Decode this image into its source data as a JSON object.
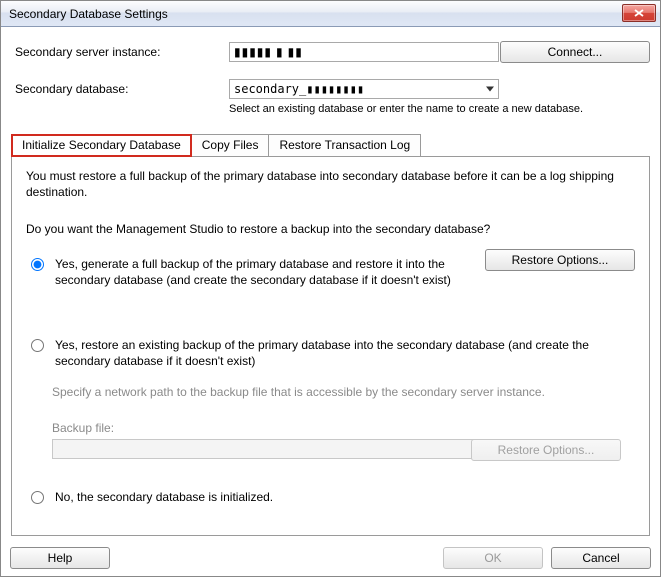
{
  "window": {
    "title": "Secondary Database Settings"
  },
  "form": {
    "server_label": "Secondary server instance:",
    "server_value": "▮▮▮▮▮ ▮ ▮▮",
    "connect_button": "Connect...",
    "db_label": "Secondary database:",
    "db_value": "secondary_▮▮▮▮▮▮▮▮",
    "db_hint": "Select an existing database or enter the name to create a new database."
  },
  "tabs": {
    "init": "Initialize Secondary Database",
    "copy": "Copy Files",
    "restore": "Restore Transaction Log"
  },
  "panel": {
    "info": "You must restore a full backup of the primary database into secondary database before it can be a log shipping destination.",
    "question": "Do you want the Management Studio to restore a backup into the secondary database?",
    "opt1": "Yes, generate a full backup of the primary database and restore it into the secondary database (and create the secondary database if it doesn't exist)",
    "restore_options": "Restore Options...",
    "opt2": "Yes, restore an existing backup of the primary database into the secondary database (and create the secondary database if it doesn't exist)",
    "path_hint": "Specify a network path to the backup file that is accessible by the secondary server instance.",
    "backup_file_label": "Backup file:",
    "restore_options_disabled": "Restore Options...",
    "opt3": "No, the secondary database is initialized."
  },
  "footer": {
    "help": "Help",
    "ok": "OK",
    "cancel": "Cancel"
  }
}
